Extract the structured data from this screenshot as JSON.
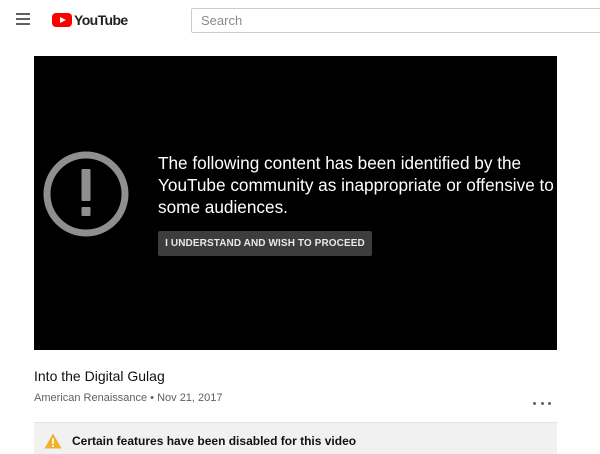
{
  "header": {
    "brand": "YouTube",
    "brand_color": "#ff0000",
    "menu_icon": "hamburger-menu-icon",
    "search": {
      "placeholder": "Search",
      "value": ""
    }
  },
  "player": {
    "warning_icon": "exclamation-circle-icon",
    "message": "The following content has been identified by the YouTube community as inappropriate or offensive to some audiences.",
    "proceed_label": "I UNDERSTAND AND WISH TO PROCEED"
  },
  "video": {
    "title": "Into the Digital Gulag",
    "meta": "American Renaissance • Nov 21, 2017",
    "more_icon": "more-horizontal-icon"
  },
  "notice": {
    "icon": "warning-triangle-icon",
    "icon_color": "#f2b02b",
    "text": "Certain features have been disabled for this video"
  }
}
